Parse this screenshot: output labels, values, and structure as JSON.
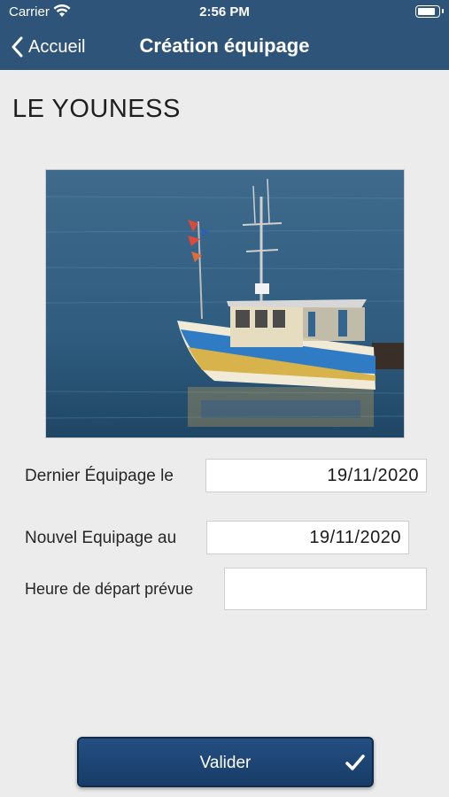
{
  "status_bar": {
    "carrier": "Carrier",
    "time": "2:56 PM"
  },
  "nav": {
    "back_label": "Accueil",
    "title": "Création équipage"
  },
  "boat": {
    "name": "LE YOUNESS"
  },
  "form": {
    "last_crew_label": "Dernier Équipage le",
    "last_crew_value": "19/11/2020",
    "new_crew_label": "Nouvel Equipage au",
    "new_crew_value": "19/11/2020",
    "departure_label": "Heure de départ prévue",
    "departure_value": ""
  },
  "submit": {
    "label": "Valider"
  },
  "colors": {
    "nav_bg": "#2f5479",
    "page_bg": "#ececec",
    "button_bg": "#1e4675"
  },
  "icons": [
    "wifi-icon",
    "battery-icon",
    "chevron-left-icon",
    "checkmark-icon"
  ]
}
